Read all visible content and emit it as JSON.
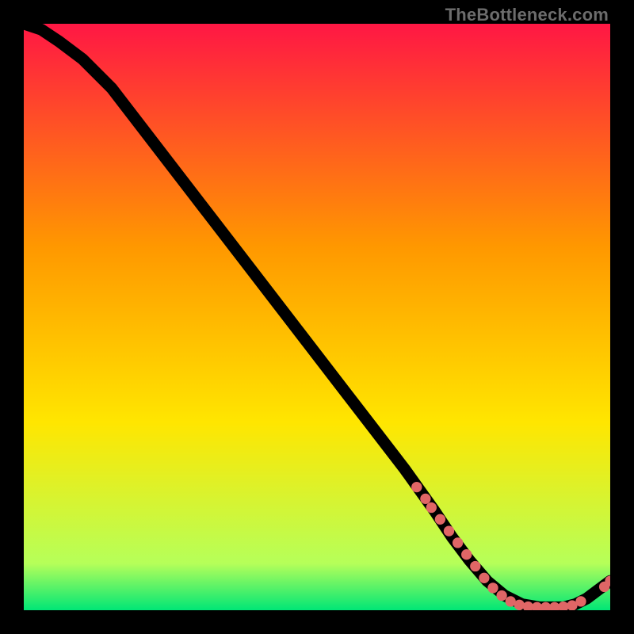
{
  "watermark": "TheBottleneck.com",
  "colors": {
    "bg_black": "#000000",
    "watermark": "#6c6c6c",
    "line": "#000000",
    "dot": "#e06666",
    "grad_top": "#ff1744",
    "grad_mid1": "#ff9800",
    "grad_mid2": "#ffe600",
    "grad_near_bottom": "#b6ff59",
    "grad_bottom": "#00e676"
  },
  "chart_data": {
    "type": "line",
    "title": "",
    "xlabel": "",
    "ylabel": "",
    "xlim": [
      0,
      100
    ],
    "ylim": [
      0,
      100
    ],
    "grid": false,
    "legend": false,
    "series": [
      {
        "name": "curve",
        "x": [
          0,
          3,
          6,
          10,
          15,
          20,
          25,
          30,
          35,
          40,
          45,
          50,
          55,
          60,
          65,
          70,
          73,
          76,
          79,
          82,
          85,
          88,
          90,
          92,
          94,
          96,
          98,
          100
        ],
        "y": [
          100,
          99,
          97,
          94,
          89,
          82.5,
          76,
          69.5,
          63,
          56.5,
          50,
          43.5,
          37,
          30.5,
          24,
          17,
          12.5,
          8.5,
          5,
          2.5,
          1,
          0.5,
          0.5,
          0.5,
          1,
          2,
          3.5,
          5
        ]
      }
    ],
    "markers": [
      {
        "x": 67,
        "y": 21
      },
      {
        "x": 68.5,
        "y": 19
      },
      {
        "x": 69.5,
        "y": 17.5
      },
      {
        "x": 71,
        "y": 15.5
      },
      {
        "x": 72.5,
        "y": 13.5
      },
      {
        "x": 74,
        "y": 11.5
      },
      {
        "x": 75.5,
        "y": 9.5
      },
      {
        "x": 77,
        "y": 7.5
      },
      {
        "x": 78.5,
        "y": 5.5
      },
      {
        "x": 80,
        "y": 3.8
      },
      {
        "x": 81.5,
        "y": 2.5
      },
      {
        "x": 83,
        "y": 1.5
      },
      {
        "x": 84.5,
        "y": 0.9
      },
      {
        "x": 86,
        "y": 0.6
      },
      {
        "x": 87.5,
        "y": 0.5
      },
      {
        "x": 89,
        "y": 0.5
      },
      {
        "x": 90.5,
        "y": 0.5
      },
      {
        "x": 92,
        "y": 0.6
      },
      {
        "x": 93.5,
        "y": 0.8
      },
      {
        "x": 95,
        "y": 1.5
      },
      {
        "x": 99,
        "y": 4
      },
      {
        "x": 100,
        "y": 5
      }
    ]
  }
}
